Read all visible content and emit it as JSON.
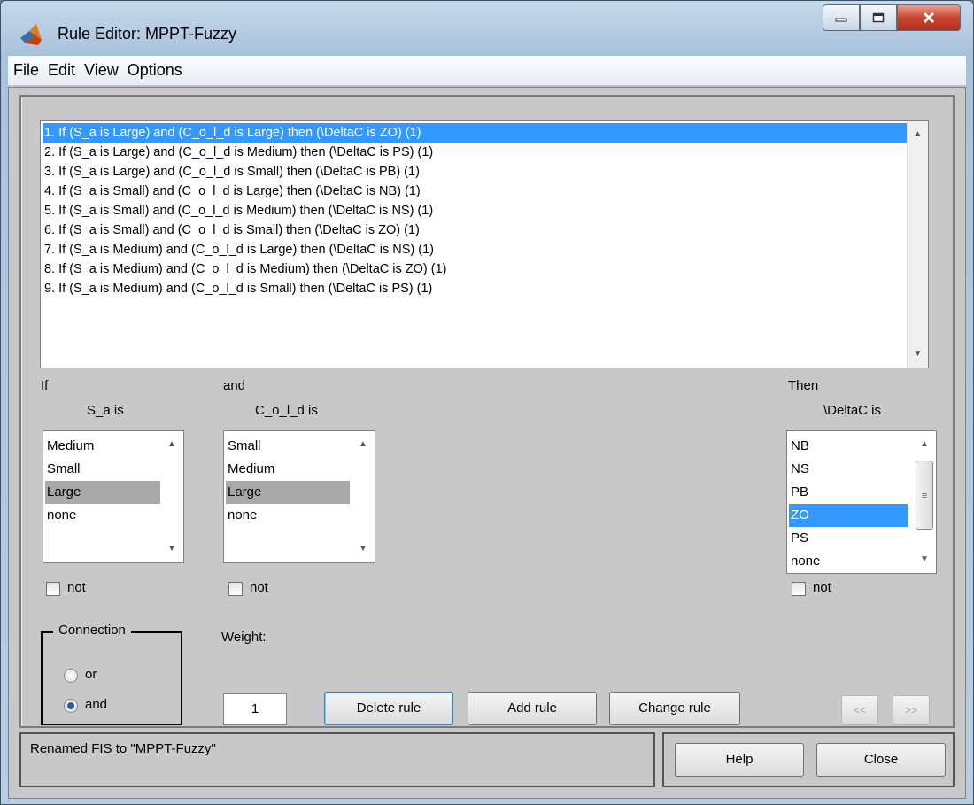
{
  "window": {
    "title": "Rule Editor: MPPT-Fuzzy"
  },
  "menu": [
    "File",
    "Edit",
    "View",
    "Options"
  ],
  "rules": [
    "1. If (S_a is Large) and (C_o_l_d is Large) then (\\DeltaC is ZO) (1)",
    "2. If (S_a is Large) and (C_o_l_d is Medium) then (\\DeltaC is PS) (1)",
    "3. If (S_a is Large) and (C_o_l_d is Small) then (\\DeltaC is PB) (1)",
    "4. If (S_a is Small) and (C_o_l_d is Large) then (\\DeltaC is NB) (1)",
    "5. If (S_a is Small) and (C_o_l_d is Medium) then (\\DeltaC is NS) (1)",
    "6. If (S_a is Small) and (C_o_l_d is Small) then (\\DeltaC is ZO) (1)",
    "7. If (S_a is Medium) and (C_o_l_d is Large) then (\\DeltaC is NS) (1)",
    "8. If (S_a is Medium) and (C_o_l_d is Medium) then (\\DeltaC is ZO) (1)",
    "9. If (S_a is Medium) and (C_o_l_d is Small) then (\\DeltaC is PS) (1)"
  ],
  "selected_rule": 1,
  "input1": {
    "header": "If",
    "var_label": "S_a is",
    "options": [
      "Medium",
      "Small",
      "Large",
      "none"
    ],
    "selected": "Large",
    "not_label": "not"
  },
  "input2": {
    "header": "and",
    "var_label": "C_o_l_d is",
    "options": [
      "Small",
      "Medium",
      "Large",
      "none"
    ],
    "selected": "Large",
    "not_label": "not"
  },
  "output": {
    "header": "Then",
    "var_label": "\\DeltaC is",
    "options": [
      "NB",
      "NS",
      "PB",
      "ZO",
      "PS",
      "none"
    ],
    "selected": "ZO",
    "not_label": "not"
  },
  "connection": {
    "title": "Connection",
    "options": [
      "or",
      "and"
    ],
    "selected": "and"
  },
  "weight": {
    "label": "Weight:",
    "value": "1"
  },
  "buttons": {
    "delete": "Delete rule",
    "add": "Add rule",
    "change": "Change rule",
    "prev": "<<",
    "next": ">>",
    "help": "Help",
    "close": "Close"
  },
  "status": "Renamed FIS to \"MPPT-Fuzzy\""
}
